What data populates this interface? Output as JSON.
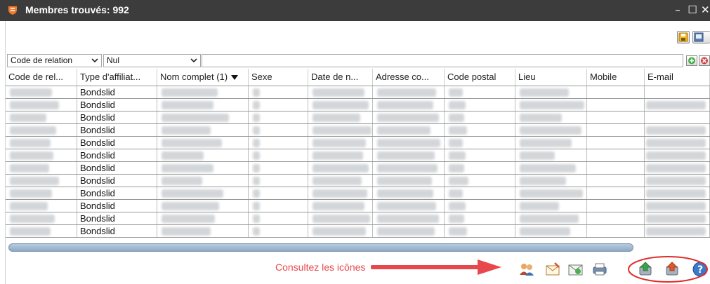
{
  "window": {
    "title": "Membres trouvés: 992",
    "minimize_glyph": "–",
    "maximize_glyph": "☐",
    "close_glyph": "✕"
  },
  "toolbar": {
    "save_icon": "floppy-save-icon",
    "export_icon": "export-icon"
  },
  "filter": {
    "field_select_value": "Code de relation",
    "operator_select_value": "Nul",
    "value_input": "",
    "add_icon": "plus-green-icon",
    "remove_icon": "x-red-icon"
  },
  "table": {
    "columns": [
      "Code de rel...",
      "Type d'affiliat...",
      "Nom complet (1)",
      "Sexe",
      "Date de n...",
      "Adresse co...",
      "Code postal",
      "Lieu",
      "Mobile",
      "E-mail"
    ],
    "sorted_column": "Nom complet (1)",
    "sort_direction": "descending",
    "rows": [
      {
        "type": "Bondslid"
      },
      {
        "type": "Bondslid"
      },
      {
        "type": "Bondslid"
      },
      {
        "type": "Bondslid"
      },
      {
        "type": "Bondslid"
      },
      {
        "type": "Bondslid"
      },
      {
        "type": "Bondslid"
      },
      {
        "type": "Bondslid"
      },
      {
        "type": "Bondslid"
      },
      {
        "type": "Bondslid"
      },
      {
        "type": "Bondslid"
      },
      {
        "type": "Bondslid"
      }
    ]
  },
  "footer": {
    "note": "Consultez les icônes",
    "icons": [
      "members-group-icon",
      "email-compose-icon",
      "email-send-icon",
      "print-icon",
      "export-green-icon",
      "export-red-icon",
      "help-icon"
    ]
  },
  "colors": {
    "titlebar": "#3c3c3c",
    "annotation_red": "#e8484c",
    "scrollbar": "#9fb7d2"
  }
}
